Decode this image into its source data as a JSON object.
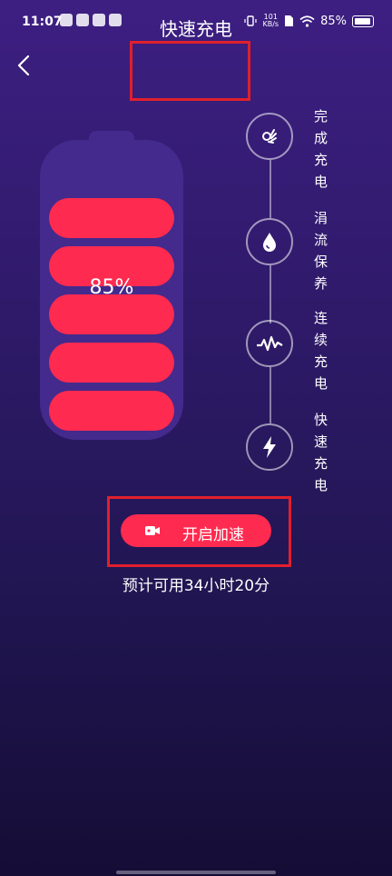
{
  "status_bar": {
    "time": "11:07",
    "net_speed_value": "101",
    "net_speed_unit": "KB/s",
    "battery_percent": "85%"
  },
  "header": {
    "title": "快速充电"
  },
  "battery": {
    "percent_label": "85%",
    "level": 0.85,
    "fill_color": "#ff2a4f"
  },
  "stages": [
    {
      "label": "完成充电",
      "icon": "ok-hand-icon"
    },
    {
      "label": "涓流保养",
      "icon": "water-drop-icon"
    },
    {
      "label": "连续充电",
      "icon": "pulse-icon"
    },
    {
      "label": "快速充电",
      "icon": "lightning-icon"
    }
  ],
  "boost": {
    "label": "开启加速",
    "icon": "video-icon"
  },
  "estimate": "预计可用34小时20分",
  "colors": {
    "accent": "#ff2a4f",
    "highlight_border": "#e0202c",
    "battery_body": "#432a8c"
  }
}
